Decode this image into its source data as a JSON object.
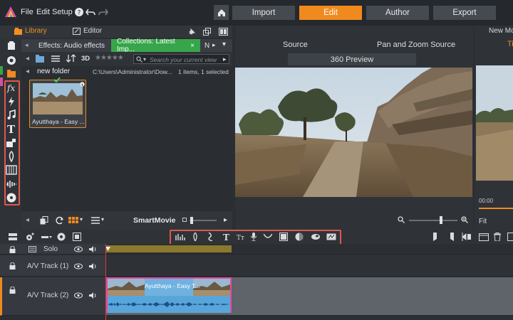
{
  "menu": {
    "file": "File",
    "edit": "Edit",
    "setup": "Setup"
  },
  "modes": {
    "import": "Import",
    "edit": "Edit",
    "author": "Author",
    "export": "Export"
  },
  "library_panel": {
    "library_tab": "Library",
    "editor_tab": "Editor"
  },
  "library": {
    "tabs": [
      "Effects: Audio effects",
      "Collections: Latest Imp...",
      "N"
    ],
    "tab_close": "×",
    "search_placeholder": "Search your current view",
    "three_d": "3D",
    "folder": "new folder",
    "path": "C:\\Users\\Administrator\\Dow...",
    "count": "1 items, 1 selected",
    "clip_name": "Ayutthaya - Easy ...",
    "smartmovie": "SmartMovie",
    "stars": "★★★★★"
  },
  "player": {
    "source_tab": "Source",
    "panzoom_tab": "Pan and Zoom Source",
    "preview_btn": "360 Preview"
  },
  "right_panel": {
    "title": "New Mo",
    "timecode": "00:00",
    "fit": "Fit",
    "label_t": "Ti"
  },
  "timeline": {
    "tracks": [
      {
        "name": "Solo"
      },
      {
        "name": "A/V Track (1)"
      },
      {
        "name": "A/V Track (2)"
      }
    ],
    "clip_label": "Ayutthaya - Easy T..."
  },
  "colors": {
    "accent": "#f08a1e",
    "highlight_box": "#e2584a",
    "collection_tab": "#37a54a",
    "clip_border": "#e24aa6"
  }
}
